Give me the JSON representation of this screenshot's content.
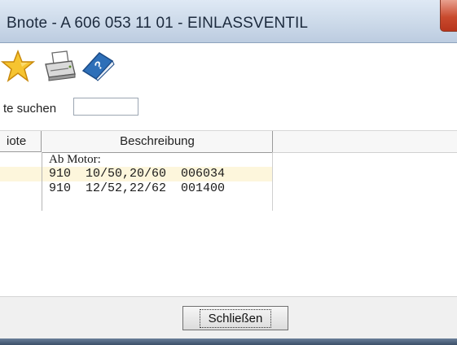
{
  "window": {
    "title": "Bnote - A 606 053 11 01 - EINLASSVENTIL"
  },
  "toolbar": {
    "icons": [
      "star-icon",
      "printer-icon",
      "help-book-icon"
    ]
  },
  "search": {
    "label": "te suchen",
    "value": ""
  },
  "table": {
    "headers": [
      "iote",
      "Beschreibung"
    ],
    "rows": [
      {
        "note": "",
        "desc": "Ab Motor:",
        "selected": false
      },
      {
        "note": "",
        "desc": "910  10/50,20/60  006034",
        "selected": true
      },
      {
        "note": "",
        "desc": "910  12/52,22/62  001400",
        "selected": false
      }
    ]
  },
  "footer": {
    "close_label": "Schließen"
  },
  "colors": {
    "title_bar": "#cfdceb",
    "close_button": "#c94a2e",
    "selected_row": "#fdf6dc"
  }
}
